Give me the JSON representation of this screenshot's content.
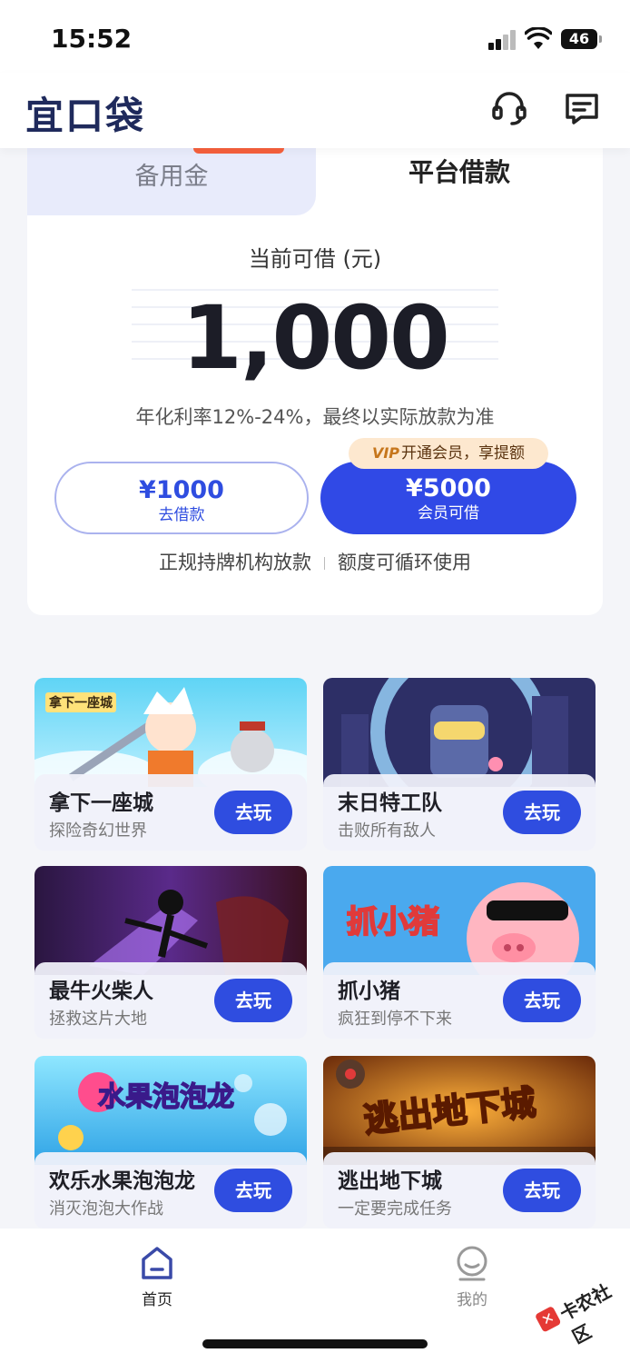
{
  "status_bar": {
    "time": "15:52",
    "battery": "46"
  },
  "app": {
    "logo": "宜口袋"
  },
  "loan_card": {
    "tabs": [
      {
        "label": "备用金",
        "active": false
      },
      {
        "label": "平台借款",
        "active": true
      }
    ],
    "limit_label": "当前可借 (元)",
    "amount": "1,000",
    "rate_text": "年化利率12%-24%，最终以实际放款为准",
    "borrow_button": {
      "amount": "¥1000",
      "label": "去借款"
    },
    "member_button": {
      "amount": "¥5000",
      "label": "会员可借"
    },
    "vip_tag": {
      "badge": "VIP",
      "text": "开通会员，享提额"
    },
    "notes": [
      "正规持牌机构放款",
      "额度可循环使用"
    ]
  },
  "games": [
    {
      "title": "拿下一座城",
      "subtitle": "探险奇幻世界",
      "art_label": "拿下一座城",
      "button": "去玩"
    },
    {
      "title": "末日特工队",
      "subtitle": "击败所有敌人",
      "art_label": "",
      "button": "去玩"
    },
    {
      "title": "最牛火柴人",
      "subtitle": "拯救这片大地",
      "art_label": "",
      "button": "去玩"
    },
    {
      "title": "抓小猪",
      "subtitle": "疯狂到停不下来",
      "art_label": "抓小猪",
      "button": "去玩"
    },
    {
      "title": "欢乐水果泡泡龙",
      "subtitle": "消灭泡泡大作战",
      "art_label": "水果泡泡龙",
      "button": "去玩"
    },
    {
      "title": "逃出地下城",
      "subtitle": "一定要完成任务",
      "art_label": "逃出地下城",
      "button": "去玩"
    }
  ],
  "tab_bar": {
    "items": [
      {
        "label": "首页",
        "icon": "home-icon",
        "active": true
      },
      {
        "label": "我的",
        "icon": "profile-icon",
        "active": false
      }
    ]
  },
  "watermark": {
    "text": "卡农社区"
  },
  "colors": {
    "primary": "#2f4de0",
    "vip_bg": "#fde8cf",
    "tab_inactive": "#e8ebfb"
  }
}
